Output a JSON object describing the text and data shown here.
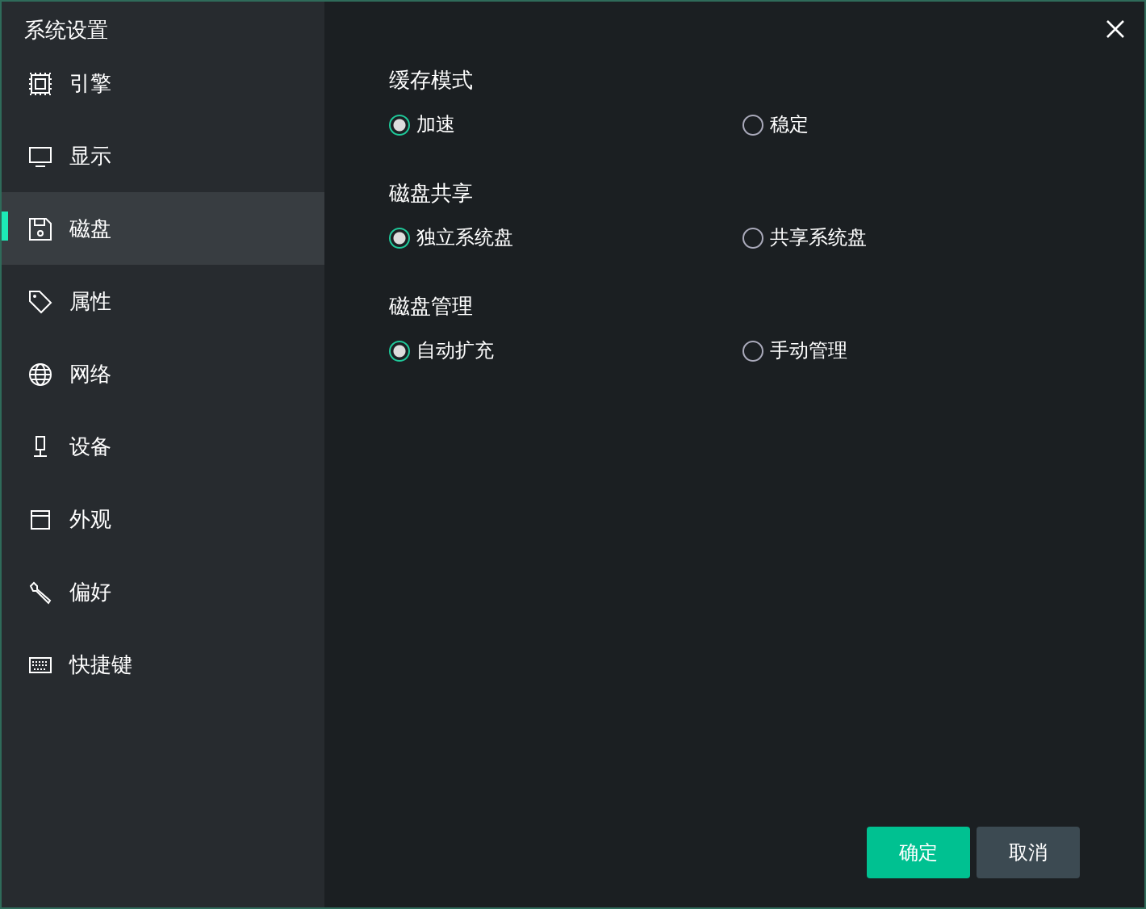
{
  "window": {
    "title": "系统设置"
  },
  "sidebar": {
    "items": [
      {
        "label": "引擎",
        "kind": "chip",
        "selected": false
      },
      {
        "label": "显示",
        "kind": "monitor",
        "selected": false
      },
      {
        "label": "磁盘",
        "kind": "disk",
        "selected": true
      },
      {
        "label": "属性",
        "kind": "tag",
        "selected": false
      },
      {
        "label": "网络",
        "kind": "globe",
        "selected": false
      },
      {
        "label": "设备",
        "kind": "mic",
        "selected": false
      },
      {
        "label": "外观",
        "kind": "window",
        "selected": false
      },
      {
        "label": "偏好",
        "kind": "wrench",
        "selected": false
      },
      {
        "label": "快捷键",
        "kind": "keyboard",
        "selected": false
      }
    ]
  },
  "sections": [
    {
      "title": "缓存模式",
      "options": [
        {
          "label": "加速",
          "selected": true
        },
        {
          "label": "稳定",
          "selected": false
        }
      ]
    },
    {
      "title": "磁盘共享",
      "options": [
        {
          "label": "独立系统盘",
          "selected": true
        },
        {
          "label": "共享系统盘",
          "selected": false
        }
      ]
    },
    {
      "title": "磁盘管理",
      "options": [
        {
          "label": "自动扩充",
          "selected": true
        },
        {
          "label": "手动管理",
          "selected": false
        }
      ]
    }
  ],
  "buttons": [
    {
      "label": "确定",
      "kind": "primary"
    },
    {
      "label": "取消",
      "kind": "secondary"
    }
  ]
}
